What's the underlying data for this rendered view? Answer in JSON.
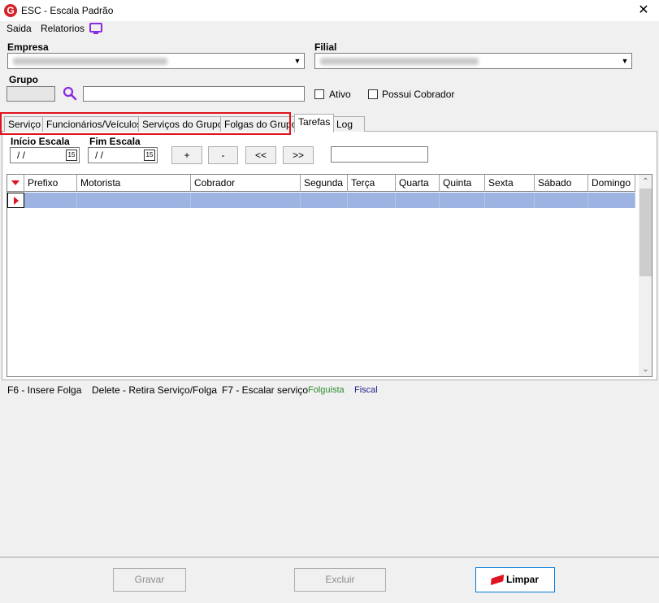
{
  "window": {
    "title": "ESC - Escala Padrão",
    "close_label": "✕",
    "logo_letter": "G"
  },
  "menu": {
    "items": [
      "Saida",
      "Relatorios"
    ]
  },
  "empresa": {
    "label": "Empresa",
    "value_blurred": true
  },
  "filial": {
    "label": "Filial",
    "value_blurred": true
  },
  "grupo": {
    "label": "Grupo",
    "code": "",
    "name": ""
  },
  "checkboxes": {
    "ativo": "Ativo",
    "possui_cobrador": "Possui Cobrador"
  },
  "tabs": [
    "Serviço",
    "Funcionários/Veículos",
    "Serviços do Grupo",
    "Folgas do Grupo",
    "Tarefas",
    "Log"
  ],
  "active_tab": "Tarefas",
  "highlight_color": "#e0141e",
  "escala": {
    "inicio_label": "Início Escala",
    "fim_label": "Fim Escala",
    "inicio_value": "/ /",
    "fim_value": "/ /",
    "calendar_day": "15"
  },
  "nav_buttons": [
    "+",
    "-",
    "<<",
    ">>"
  ],
  "search_value": "",
  "grid": {
    "columns": [
      "Prefixo",
      "Motorista",
      "Cobrador",
      "Segunda",
      "Terça",
      "Quarta",
      "Quinta",
      "Sexta",
      "Sábado",
      "Domingo"
    ],
    "selected_row_color": "#9db4e3"
  },
  "legend": {
    "f6": "F6 - Insere Folga",
    "delete": "Delete - Retira Serviço/Folga",
    "f7": "F7 - Escalar serviço",
    "folguista": "Folguista",
    "folguista_color": "#2e8b2e",
    "fiscal": "Fiscal",
    "fiscal_color": "#1f1f8c"
  },
  "buttons": {
    "gravar": "Gravar",
    "excluir": "Excluir",
    "limpar": "Limpar"
  }
}
